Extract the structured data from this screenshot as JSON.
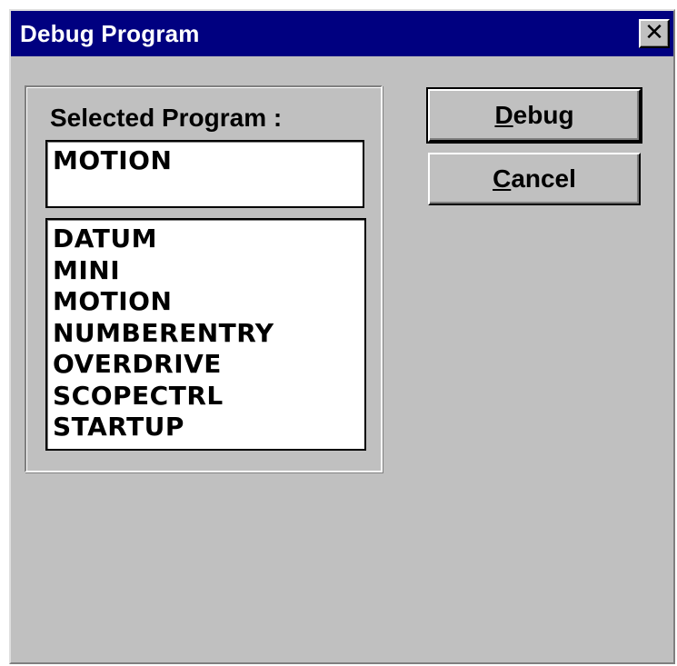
{
  "window": {
    "title": "Debug Program",
    "close_glyph": "✕"
  },
  "selected_program": {
    "label": "Selected Program :",
    "value": "MOTION"
  },
  "program_list": {
    "items": [
      "DATUM",
      "MINI",
      "MOTION",
      "NUMBERENTRY",
      "OVERDRIVE",
      "SCOPECTRL",
      "STARTUP"
    ]
  },
  "buttons": {
    "debug": {
      "mnemonic": "D",
      "rest": "ebug"
    },
    "cancel": {
      "mnemonic": "C",
      "rest": "ancel"
    }
  },
  "colors": {
    "titlebar": "#000080",
    "face": "#c0c0c0",
    "field": "#ffffff"
  },
  "icons": {
    "close": "close-icon"
  }
}
